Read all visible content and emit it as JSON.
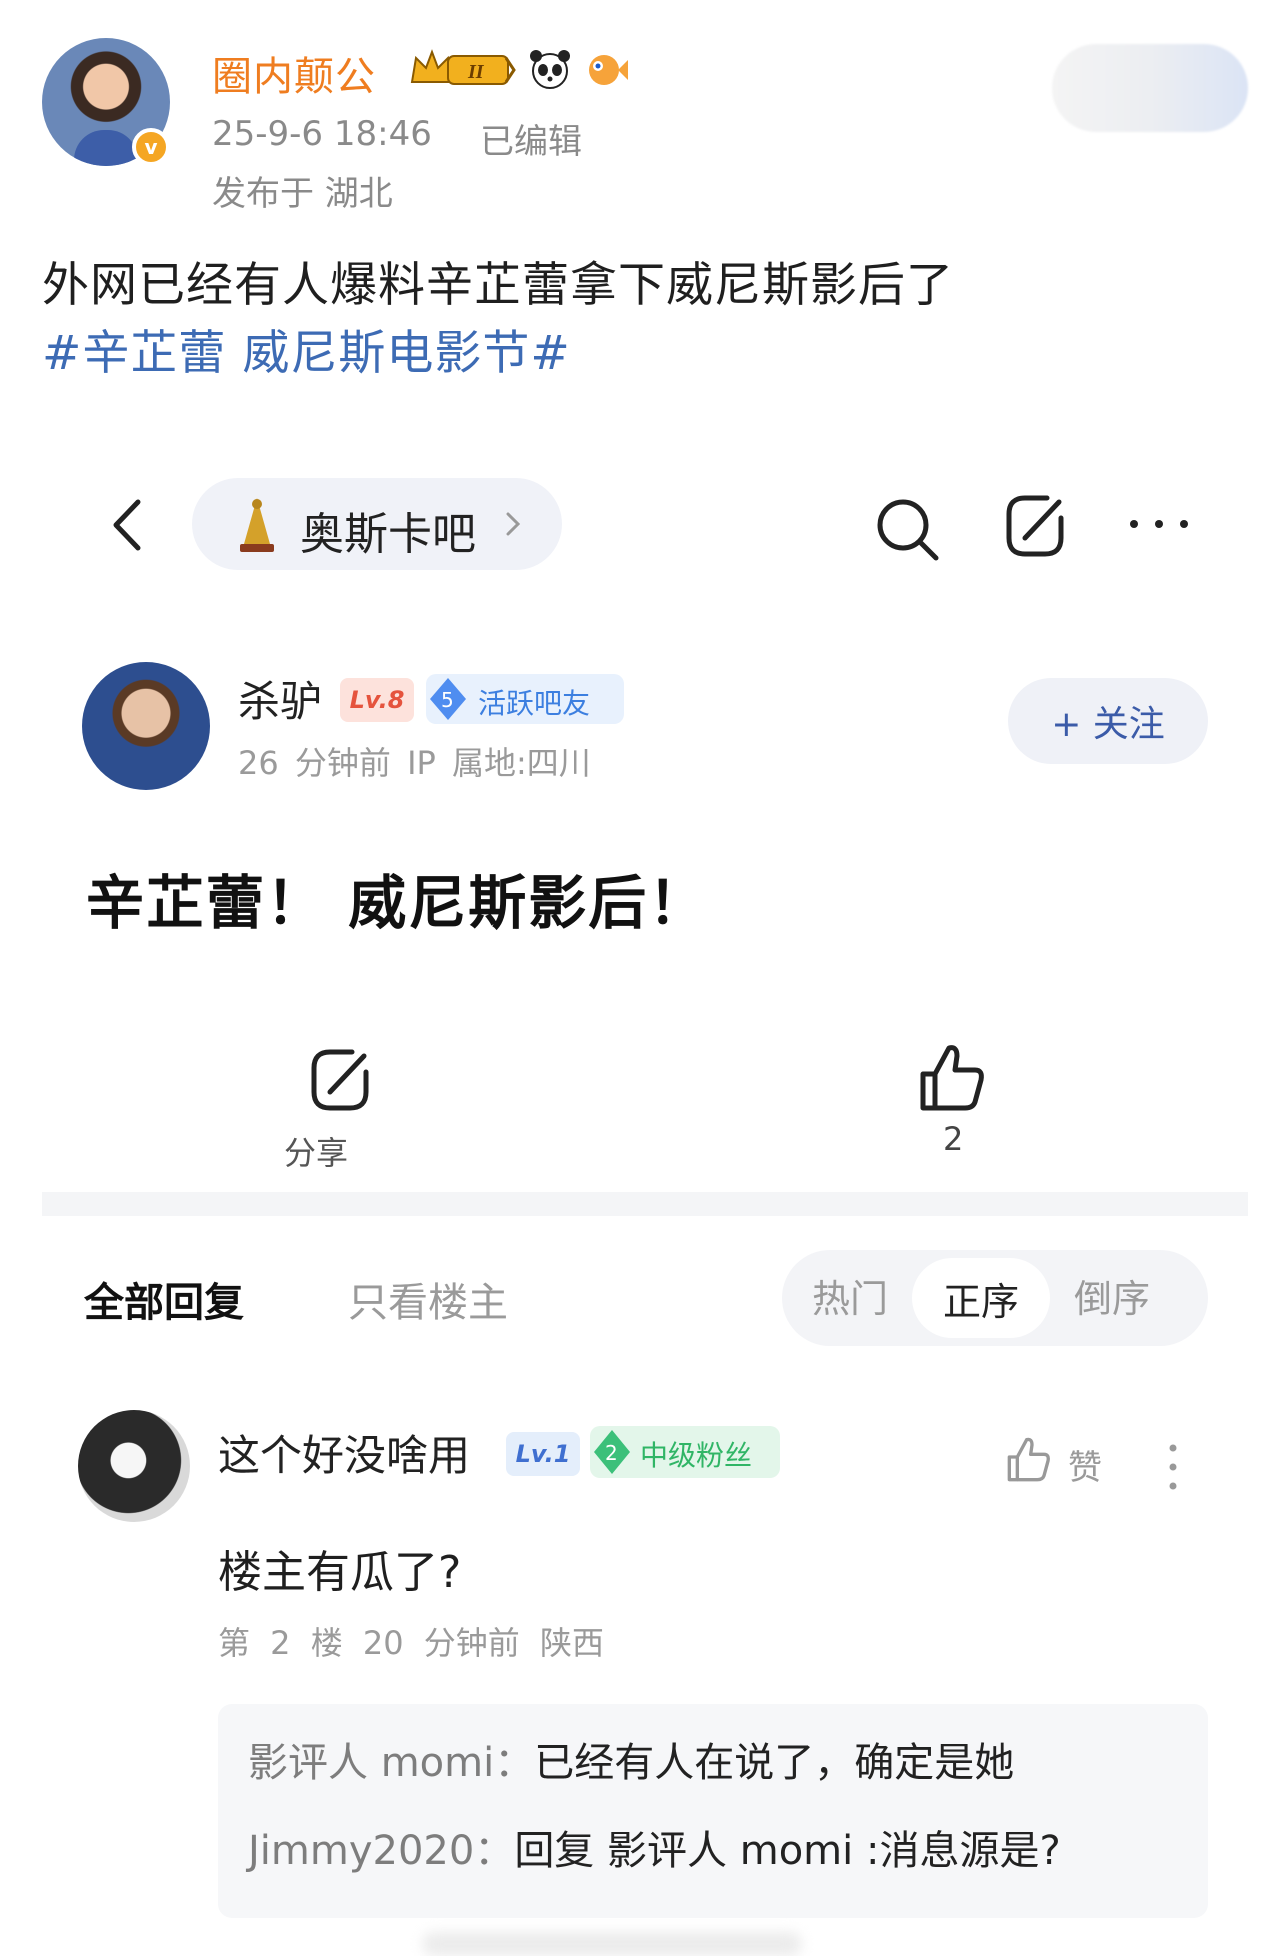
{
  "weibo": {
    "username": "圈内颠公",
    "time": "25-9-6 18:46",
    "edited": "已编辑",
    "location": "发布于 湖北",
    "verify_mark": "v",
    "text": "外网已经有人爆料辛芷蕾拿下威尼斯影后了",
    "topic": "#辛芷蕾 威尼斯电影节#",
    "colors": {
      "username": "#ef7d20",
      "topic": "#3d6bb4"
    }
  },
  "tieba": {
    "forum_name": "奥斯卡吧",
    "post": {
      "username": "杀驴",
      "level": "Lv.8",
      "fan_rank": "5",
      "fan_title": "活跃吧友",
      "meta": "26 分钟前   IP 属地:四川",
      "follow_label": "+ 关注",
      "title": "辛芷蕾！ 威尼斯影后！",
      "share_label": "分享",
      "like_count": "2"
    },
    "tabs": {
      "all": "全部回复",
      "op_only": "只看楼主"
    },
    "sort": {
      "hot": "热门",
      "asc": "正序",
      "desc": "倒序",
      "selected": "正序"
    },
    "reply": {
      "username": "这个好没啥用",
      "level": "Lv.1",
      "fan_rank": "2",
      "fan_title": "中级粉丝",
      "like_label": "赞",
      "content": "楼主有瓜了?",
      "meta": "第 2 楼  20 分钟前  陕西",
      "subreplies": [
        {
          "author": "影评人 momi：",
          "text": "已经有人在说了，确定是她"
        },
        {
          "author": "Jimmy2020：",
          "text": "回复 影评人 momi :消息源是?"
        }
      ]
    }
  }
}
